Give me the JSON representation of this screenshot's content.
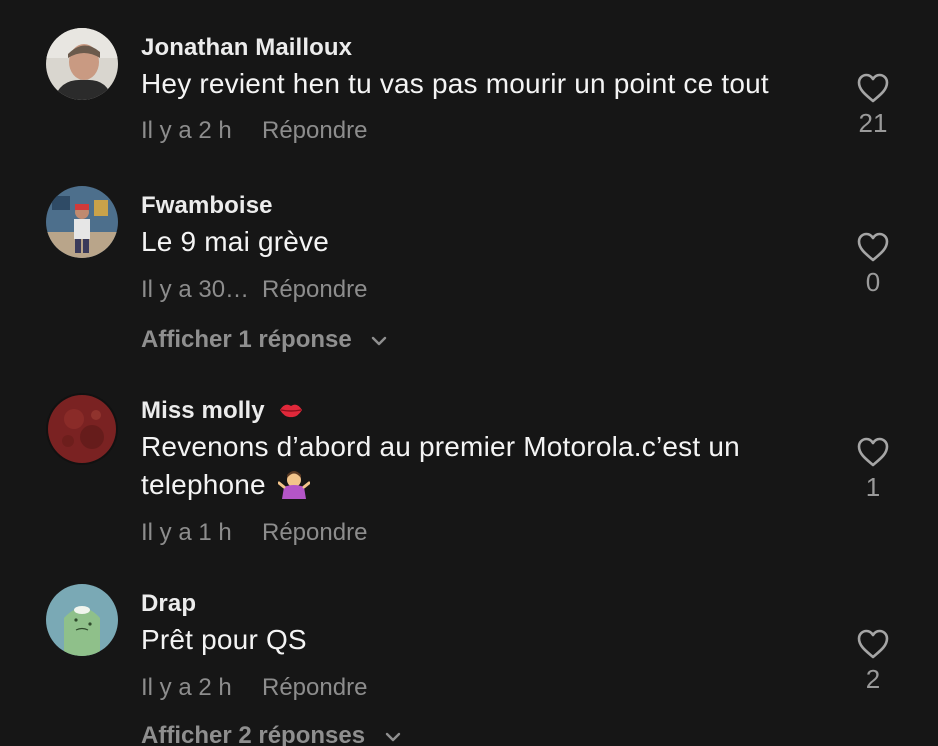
{
  "comments": [
    {
      "username": "Jonathan Mailloux",
      "text": "Hey revient hen tu vas pas mourir un point ce tout",
      "time": "Il y a 2 h",
      "reply_label": "Répondre",
      "likes": "21"
    },
    {
      "username": "Fwamboise",
      "text": "Le 9 mai grève",
      "time": "Il y a 30…",
      "reply_label": "Répondre",
      "likes": "0",
      "view_replies": "Afficher 1 réponse"
    },
    {
      "username": "Miss molly",
      "username_emoji": "lips-emoji",
      "text": "Revenons d’abord au premier Motorola.c’est un telephone",
      "text_emoji": "shrug-emoji",
      "time": "Il y a 1 h",
      "reply_label": "Répondre",
      "likes": "1"
    },
    {
      "username": "Drap",
      "text": "Prêt pour QS",
      "time": "Il y a 2 h",
      "reply_label": "Répondre",
      "likes": "2",
      "view_replies": "Afficher 2 réponses"
    }
  ],
  "icons": {
    "like": "heart-outline-icon",
    "expand": "chevron-down-icon"
  },
  "colors": {
    "background": "#161616",
    "primary_text": "#f4f4f4",
    "secondary_text": "#8d8d8d"
  }
}
